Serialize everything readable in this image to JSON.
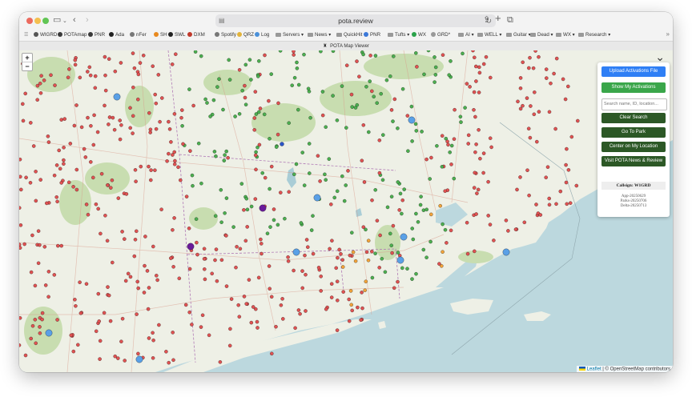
{
  "browser": {
    "url": "pota.review",
    "tab_title": "POTA Map Viewer",
    "bookmarks": [
      {
        "label": "WIGRD",
        "icon": "wifi-icon",
        "color": "#555555"
      },
      {
        "label": "POTAmap",
        "icon": "pota-icon",
        "color": "#3a3a3a"
      },
      {
        "label": "PNR",
        "icon": "pnr-icon",
        "color": "#3a3a3a"
      },
      {
        "label": "Ada",
        "icon": "ada-icon",
        "color": "#222222"
      },
      {
        "label": "nFer",
        "icon": "globe-icon",
        "color": "#777777"
      },
      {
        "label": "SH",
        "icon": "sh-icon",
        "color": "#e8891f"
      },
      {
        "label": "SWL",
        "icon": "swl-icon",
        "color": "#222222"
      },
      {
        "label": "DXM",
        "icon": "dxm-icon",
        "color": "#c0392b"
      },
      {
        "label": "Spotify",
        "icon": "globe-icon",
        "color": "#777777"
      },
      {
        "label": "QRZ",
        "icon": "qrz-icon",
        "color": "#e2b33a"
      },
      {
        "label": "Log",
        "icon": "log-icon",
        "color": "#4a90d9"
      },
      {
        "label": "Servers ▾",
        "icon": "folder-icon",
        "color": "#999999"
      },
      {
        "label": "News ▾",
        "icon": "folder-icon",
        "color": "#999999"
      },
      {
        "label": "QuickHit ▾",
        "icon": "folder-icon",
        "color": "#999999"
      },
      {
        "label": "PNR",
        "icon": "pnr-icon",
        "color": "#3b78d8"
      },
      {
        "label": "Tufts ▾",
        "icon": "folder-icon",
        "color": "#999999"
      },
      {
        "label": "WX",
        "icon": "wx-icon",
        "color": "#2aa24a"
      },
      {
        "label": "GRD*",
        "icon": "grd-icon",
        "color": "#999999"
      },
      {
        "label": "AI ▾",
        "icon": "folder-icon",
        "color": "#999999"
      },
      {
        "label": "WELL ▾",
        "icon": "folder-icon",
        "color": "#999999"
      },
      {
        "label": "Guitar ▾",
        "icon": "folder-icon",
        "color": "#999999"
      },
      {
        "label": "Dead ▾",
        "icon": "folder-icon",
        "color": "#999999"
      },
      {
        "label": "WX ▾",
        "icon": "folder-icon",
        "color": "#999999"
      },
      {
        "label": "Research ▾",
        "icon": "folder-icon",
        "color": "#999999"
      }
    ]
  },
  "map": {
    "zoom_in": "+",
    "zoom_out": "−",
    "attribution_leaflet": "Leaflet",
    "attribution_rest": " | © OpenStreetMap contributors",
    "marker_colors": {
      "activated": "#4caf50",
      "not_activated": "#e05252",
      "recent": "#f2a33a",
      "center": "#5aa0e6",
      "special": "#6a1b9a"
    },
    "water_color": "#bcd8de",
    "land_color": "#eef0e6",
    "forest_color": "#c8ddb0"
  },
  "panel": {
    "upload_label": "Upload Activations File",
    "show_label": "Show My Activations",
    "search_placeholder": "Search name, ID, location...",
    "clear_label": "Clear Search",
    "goto_label": "Go To Park",
    "center_label": "Center on My Location",
    "visit_label": "Visit POTA News & Review",
    "callsign": "Callsign: W1GRD",
    "app_version": "App-20250629",
    "parks_version": "Parks-20250706",
    "delta_version": "Delta-20250713"
  }
}
